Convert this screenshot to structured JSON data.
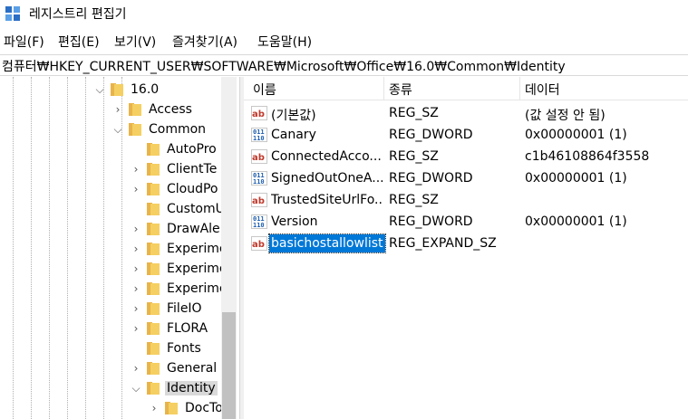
{
  "window": {
    "title": "레지스트리 편집기"
  },
  "menu": [
    "파일(F)",
    "편집(E)",
    "보기(V)",
    "즐겨찾기(A)",
    "도움말(H)"
  ],
  "address": "컴퓨터₩HKEY_CURRENT_USER₩SOFTWARE₩Microsoft₩Office₩16.0₩Common₩Identity",
  "tree": [
    {
      "label": "16.0",
      "state": "expanded"
    },
    {
      "label": "Access",
      "state": "collapsed"
    },
    {
      "label": "Common",
      "state": "expanded"
    },
    {
      "label": "AutoPro",
      "state": "none"
    },
    {
      "label": "ClientTe",
      "state": "collapsed"
    },
    {
      "label": "CloudPo",
      "state": "collapsed"
    },
    {
      "label": "CustomU",
      "state": "none"
    },
    {
      "label": "DrawAle",
      "state": "collapsed"
    },
    {
      "label": "Experime",
      "state": "collapsed"
    },
    {
      "label": "Experime",
      "state": "collapsed"
    },
    {
      "label": "Experime",
      "state": "collapsed"
    },
    {
      "label": "FileIO",
      "state": "collapsed"
    },
    {
      "label": "FLORA",
      "state": "collapsed"
    },
    {
      "label": "Fonts",
      "state": "none"
    },
    {
      "label": "General",
      "state": "collapsed"
    },
    {
      "label": "Identity",
      "state": "expanded",
      "selected": true
    },
    {
      "label": "DocTo",
      "state": "collapsed"
    }
  ],
  "columns": {
    "name": "이름",
    "type": "종류",
    "data": "데이터"
  },
  "values": [
    {
      "name": "(기본값)",
      "type": "REG_SZ",
      "data": "(값 설정 안 됨)",
      "icon": "string-value-icon"
    },
    {
      "name": "Canary",
      "type": "REG_DWORD",
      "data": "0x00000001 (1)",
      "icon": "binary-value-icon"
    },
    {
      "name": "ConnectedAcco...",
      "type": "REG_SZ",
      "data": "c1b46108864f3558",
      "icon": "string-value-icon"
    },
    {
      "name": "SignedOutOneA...",
      "type": "REG_DWORD",
      "data": "0x00000001 (1)",
      "icon": "binary-value-icon"
    },
    {
      "name": "TrustedSiteUrlFo...",
      "type": "REG_SZ",
      "data": "",
      "icon": "string-value-icon"
    },
    {
      "name": "Version",
      "type": "REG_DWORD",
      "data": "0x00000001 (1)",
      "icon": "binary-value-icon"
    },
    {
      "name": "basichostallowlist",
      "type": "REG_EXPAND_SZ",
      "data": "",
      "icon": "string-value-icon",
      "selected": true
    }
  ]
}
